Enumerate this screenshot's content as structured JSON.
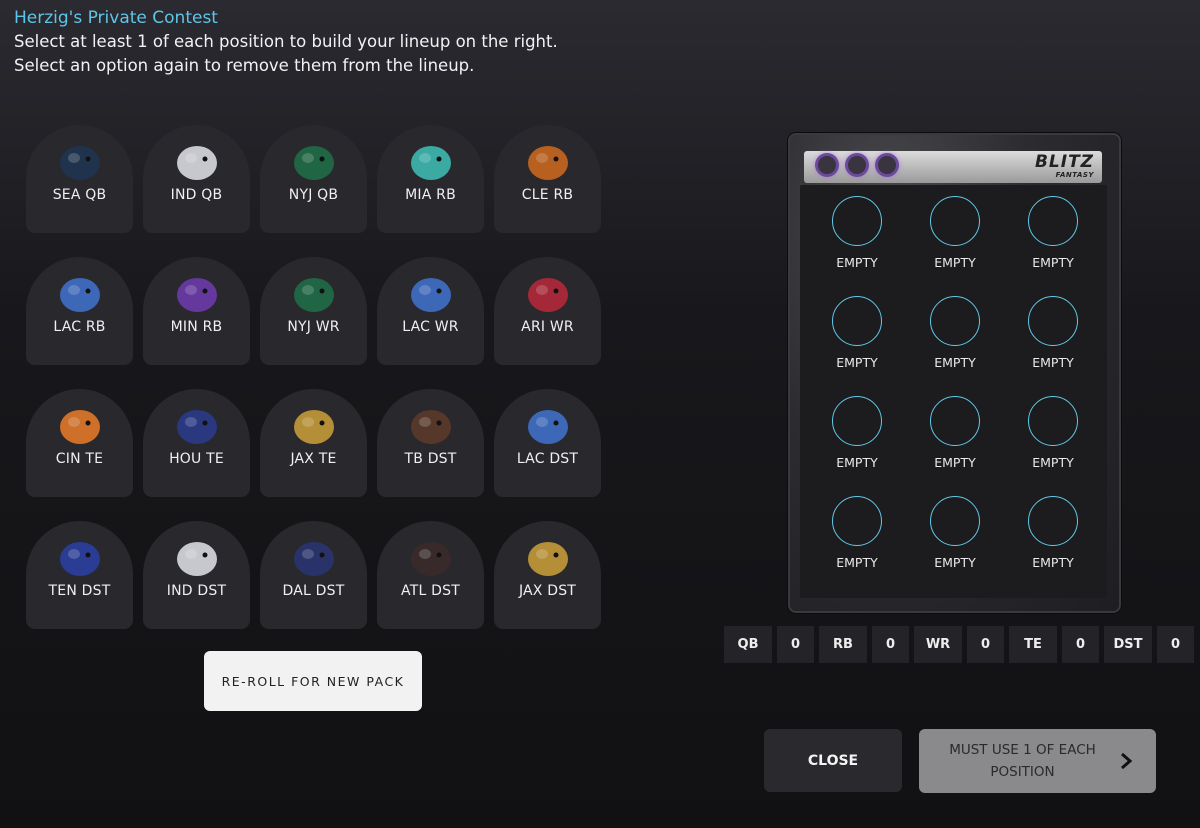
{
  "header": {
    "contest_title": "Herzig's Private Contest",
    "instruction_1": "Select at least 1 of each position to build your lineup on the right.",
    "instruction_2": "Select an option again to remove them from the lineup."
  },
  "pack": [
    {
      "label": "SEA QB",
      "icon": "seahawk-icon",
      "color": "#1e3550"
    },
    {
      "label": "IND QB",
      "icon": "horse-icon",
      "color": "#d8d8e0"
    },
    {
      "label": "NYJ QB",
      "icon": "jet-icon",
      "color": "#1f6b47"
    },
    {
      "label": "MIA RB",
      "icon": "dolphin-icon",
      "color": "#3cb8b0"
    },
    {
      "label": "CLE RB",
      "icon": "bulldog-icon",
      "color": "#c8661e"
    },
    {
      "label": "LAC RB",
      "icon": "lightning-horse-icon",
      "color": "#3f6fc8"
    },
    {
      "label": "MIN RB",
      "icon": "viking-helmet-icon",
      "color": "#6a3aa8"
    },
    {
      "label": "NYJ WR",
      "icon": "jet-icon",
      "color": "#1f6b47"
    },
    {
      "label": "LAC WR",
      "icon": "lightning-horse-icon",
      "color": "#3f6fc8"
    },
    {
      "label": "ARI WR",
      "icon": "cardinal-icon",
      "color": "#b3283a"
    },
    {
      "label": "CIN TE",
      "icon": "tiger-icon",
      "color": "#e0782a"
    },
    {
      "label": "HOU TE",
      "icon": "bull-icon",
      "color": "#2a3a8a"
    },
    {
      "label": "JAX TE",
      "icon": "jaguar-icon",
      "color": "#c49a3a"
    },
    {
      "label": "TB DST",
      "icon": "pirate-icon",
      "color": "#5a3a2a"
    },
    {
      "label": "LAC DST",
      "icon": "lightning-horse-icon",
      "color": "#3f6fc8"
    },
    {
      "label": "TEN DST",
      "icon": "titan-icon",
      "color": "#2a3ea0"
    },
    {
      "label": "IND DST",
      "icon": "horse-icon",
      "color": "#d8d8e0"
    },
    {
      "label": "DAL DST",
      "icon": "cowboy-icon",
      "color": "#2a3470"
    },
    {
      "label": "ATL DST",
      "icon": "falcon-icon",
      "color": "#3a2a2a"
    },
    {
      "label": "JAX DST",
      "icon": "jaguar-icon",
      "color": "#c49a3a"
    }
  ],
  "reroll_label": "RE-ROLL FOR NEW PACK",
  "board": {
    "logo": "BLITZ",
    "logo_sub": "FANTASY",
    "slots": [
      "EMPTY",
      "EMPTY",
      "EMPTY",
      "EMPTY",
      "EMPTY",
      "EMPTY",
      "EMPTY",
      "EMPTY",
      "EMPTY",
      "EMPTY",
      "EMPTY",
      "EMPTY"
    ],
    "ring_color": "#5fc8e6"
  },
  "counts": [
    {
      "pos": "QB",
      "count": "0"
    },
    {
      "pos": "RB",
      "count": "0"
    },
    {
      "pos": "WR",
      "count": "0"
    },
    {
      "pos": "TE",
      "count": "0"
    },
    {
      "pos": "DST",
      "count": "0"
    }
  ],
  "buttons": {
    "close": "CLOSE",
    "submit_line1": "MUST USE 1 OF EACH",
    "submit_line2": "POSITION"
  },
  "colors": {
    "accent": "#5ec5e8",
    "card_bg": "#28282d"
  }
}
